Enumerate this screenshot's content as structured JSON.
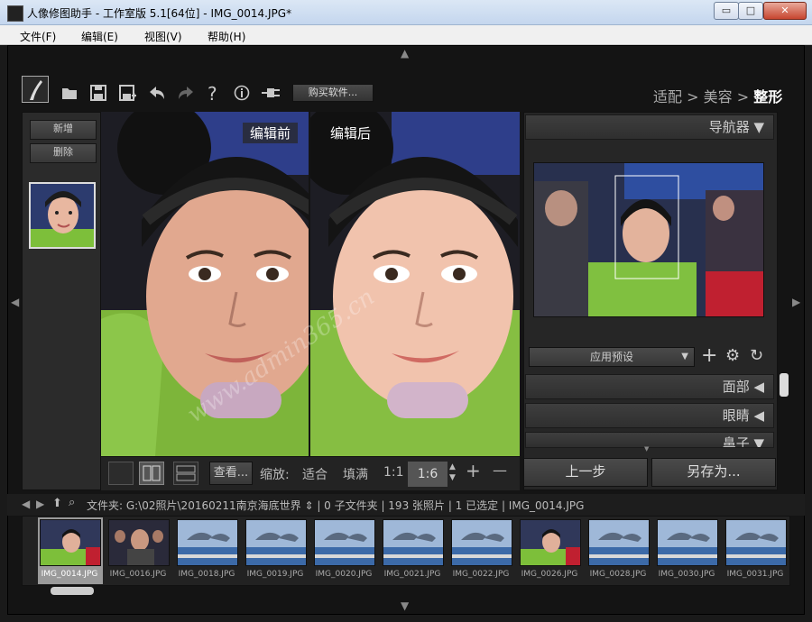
{
  "window": {
    "title": "人像修图助手 - 工作室版 5.1[64位] - IMG_0014.JPG*",
    "controls": {
      "minimize": "▭",
      "maximize": "□",
      "close": "✕"
    }
  },
  "menu": {
    "items": [
      "文件(F)",
      "编辑(E)",
      "视图(V)",
      "帮助(H)"
    ]
  },
  "toolbar": {
    "buy_label": "购买软件...",
    "icons": [
      "logo-icon",
      "open-folder-icon",
      "save-icon",
      "save-as-icon",
      "undo-icon",
      "redo-icon",
      "help-icon",
      "info-icon",
      "plugin-icon"
    ]
  },
  "workflow": {
    "step1": "适配",
    "sep": " > ",
    "step2": "美容",
    "step3": "整形"
  },
  "left_panel": {
    "add_label": "新增",
    "delete_label": "删除"
  },
  "preview": {
    "before_label": "编辑前",
    "after_label": "编辑后",
    "watermark": "www.admin365.cn"
  },
  "view_bar": {
    "view_label": "查看...",
    "zoom_label": "缩放:",
    "fit_label": "适合",
    "fill_label": "填满",
    "ratio_1_1": "1:1",
    "ratio_current": "1:6",
    "plus": "+",
    "minus": "—"
  },
  "right_panel": {
    "navigator_title": "导航器 ▼",
    "preset_label": "应用预设",
    "sections": [
      "面部 ◀",
      "眼睛 ◀",
      "鼻子 ▼"
    ],
    "prev_step": "上一步",
    "save_as": "另存为..."
  },
  "status": {
    "text": "文件夹:  G:\\02照片\\20160211南京海底世界 ⇕ | 0 子文件夹 | 193 张照片 | 1 已选定 | IMG_0014.JPG"
  },
  "filmstrip": {
    "items": [
      {
        "name": "IMG_0014.JPG",
        "kind": "girl"
      },
      {
        "name": "IMG_0016.JPG",
        "kind": "crowd"
      },
      {
        "name": "IMG_0018.JPG",
        "kind": "dolphin"
      },
      {
        "name": "IMG_0019.JPG",
        "kind": "dolphin"
      },
      {
        "name": "IMG_0020.JPG",
        "kind": "dolphin"
      },
      {
        "name": "IMG_0021.JPG",
        "kind": "dolphin"
      },
      {
        "name": "IMG_0022.JPG",
        "kind": "dolphin"
      },
      {
        "name": "IMG_0026.JPG",
        "kind": "girl"
      },
      {
        "name": "IMG_0028.JPG",
        "kind": "dolphin"
      },
      {
        "name": "IMG_0030.JPG",
        "kind": "dolphin"
      },
      {
        "name": "IMG_0031.JPG",
        "kind": "dolphin"
      }
    ]
  }
}
